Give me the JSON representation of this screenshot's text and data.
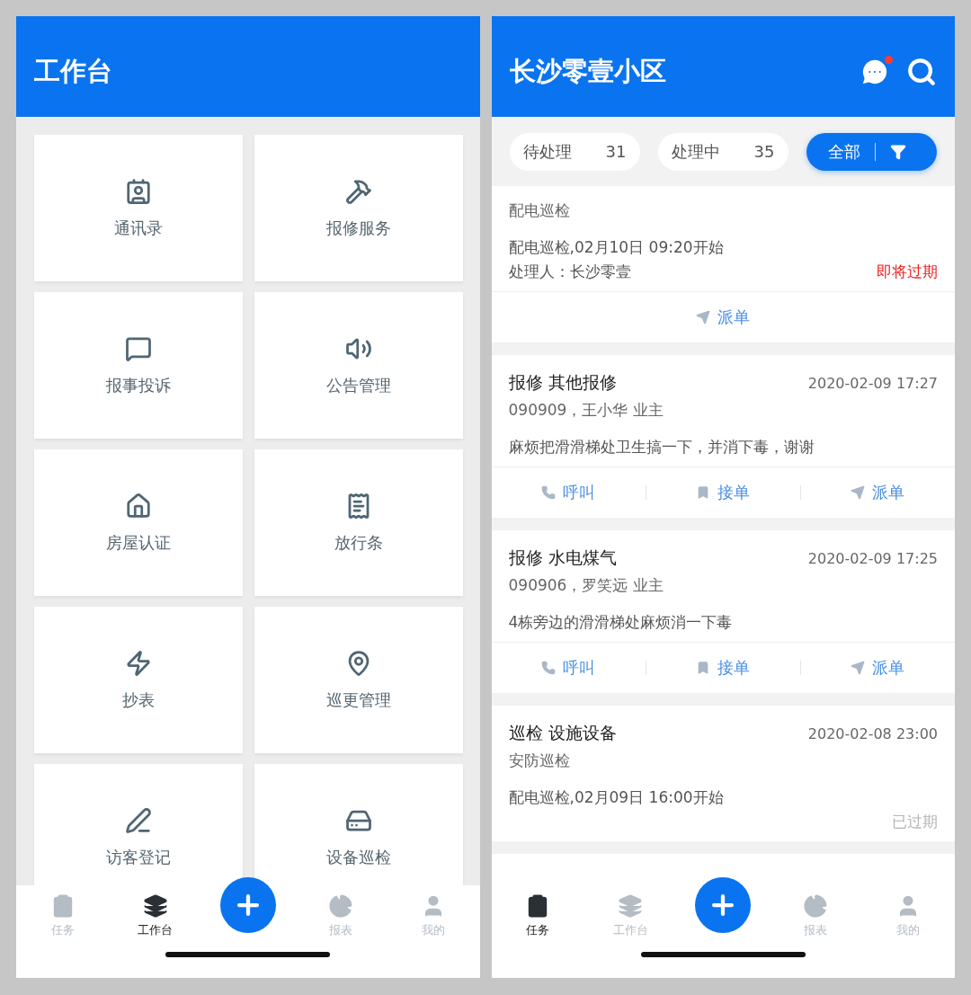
{
  "screens": [
    {
      "kind": "workbench",
      "header": {
        "title": "工作台"
      },
      "tiles": [
        {
          "label": "通讯录"
        },
        {
          "label": "报修服务"
        },
        {
          "label": "报事投诉"
        },
        {
          "label": "公告管理"
        },
        {
          "label": "房屋认证"
        },
        {
          "label": "放行条"
        },
        {
          "label": "抄表"
        },
        {
          "label": "巡更管理"
        },
        {
          "label": "访客登记"
        },
        {
          "label": "设备巡检"
        }
      ],
      "nav": [
        {
          "label": "任务",
          "selected": false
        },
        {
          "label": "工作台",
          "selected": true
        },
        {
          "label": "报表",
          "selected": false
        },
        {
          "label": "我的",
          "selected": false
        }
      ]
    },
    {
      "kind": "tasks",
      "header": {
        "title": "长沙零壹小区",
        "unread": true
      },
      "filters": [
        {
          "label": "待处理",
          "count": "31",
          "selected": false
        },
        {
          "label": "处理中",
          "count": "35",
          "selected": false
        },
        {
          "label": "全部",
          "selected": true
        }
      ],
      "tasks": [
        {
          "subtitle": "配电巡检",
          "description": "配电巡检,02月10日 09:20开始",
          "handler": "处理人：长沙零壹",
          "status": {
            "text": "即将过期",
            "kind": "due-soon"
          },
          "actions": [
            {
              "kind": "dispatch",
              "label": "派单"
            }
          ]
        },
        {
          "title": "报修 其他报修",
          "time": "2020-02-09 17:27",
          "subtitle": "090909，王小华 业主",
          "description": "麻烦把滑滑梯处卫生搞一下，并消下毒，谢谢",
          "actions": [
            {
              "kind": "call",
              "label": "呼叫"
            },
            {
              "kind": "accept",
              "label": "接单"
            },
            {
              "kind": "dispatch",
              "label": "派单"
            }
          ]
        },
        {
          "title": "报修 水电煤气",
          "time": "2020-02-09 17:25",
          "subtitle": "090906，罗笑远 业主",
          "description": "4栋旁边的滑滑梯处麻烦消一下毒",
          "actions": [
            {
              "kind": "call",
              "label": "呼叫"
            },
            {
              "kind": "accept",
              "label": "接单"
            },
            {
              "kind": "dispatch",
              "label": "派单"
            }
          ]
        },
        {
          "title": "巡检 设施设备",
          "time": "2020-02-08 23:00",
          "subtitle": "安防巡检",
          "description": "配电巡检,02月09日 16:00开始",
          "status": {
            "text": "已过期",
            "kind": "expired"
          }
        }
      ],
      "nav": [
        {
          "label": "任务",
          "selected": true
        },
        {
          "label": "工作台",
          "selected": false
        },
        {
          "label": "报表",
          "selected": false
        },
        {
          "label": "我的",
          "selected": false
        }
      ]
    }
  ]
}
